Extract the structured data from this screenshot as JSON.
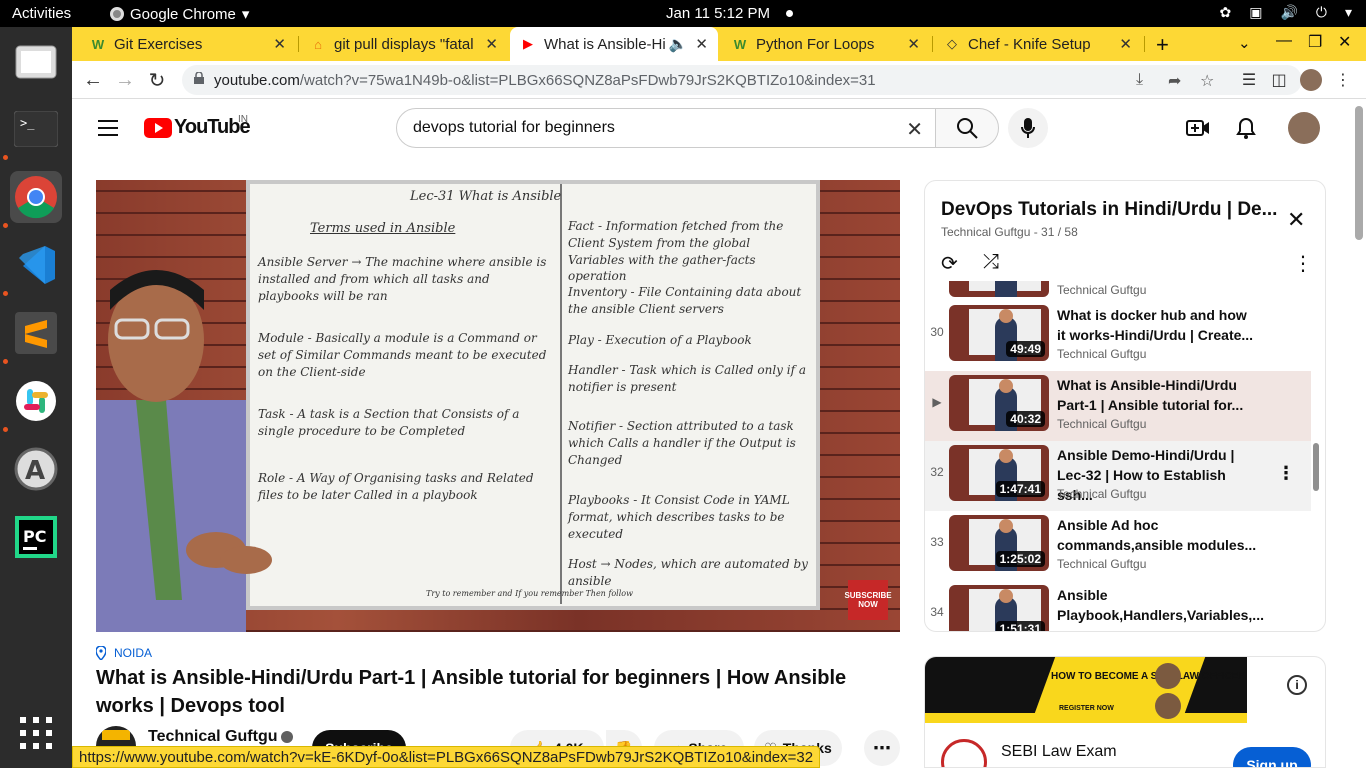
{
  "topbar": {
    "activities": "Activities",
    "app_name": "Google Chrome",
    "datetime": "Jan 11  5:12 PM"
  },
  "dock": {
    "apps": [
      "files-icon",
      "terminal-icon",
      "chrome-icon",
      "vscode-icon",
      "sublime-icon",
      "slack-icon",
      "software-updater-icon",
      "pycharm-icon",
      "app-grid-icon"
    ]
  },
  "tabs": [
    {
      "title": "Git Exercises",
      "favicon": "W"
    },
    {
      "title": "git pull displays \"fatal",
      "favicon": "⌂"
    },
    {
      "title": "What is Ansible-Hi",
      "favicon": "▶",
      "active": true
    },
    {
      "title": "Python For Loops",
      "favicon": "W"
    },
    {
      "title": "Chef - Knife Setup",
      "favicon": "◇"
    }
  ],
  "address_bar": {
    "domain": "youtube.com",
    "path": "/watch?v=75wa1N49b-o&list=PLBGx66SQNZ8aPsFDwb79JrS2KQBTIZo10&index=31"
  },
  "youtube": {
    "logo_text": "YouTube",
    "country": "IN",
    "search_value": "devops tutorial for beginners"
  },
  "video": {
    "location": "NOIDA",
    "title": "What is Ansible-Hindi/Urdu Part-1 | Ansible tutorial for beginners | How Ansible works | Devops tool",
    "channel": "Technical Guftgu",
    "subscribe_label": "Subscribe",
    "likes": "4.0K",
    "share_label": "Share",
    "thanks_label": "Thanks",
    "whiteboard": {
      "header": "Lec-31  What is Ansible",
      "left_title": "Terms used in Ansible",
      "left": [
        "Ansible Server → The machine where ansible is installed and from which all tasks and playbooks will be ran",
        "Module - Basically a module is a Command or set of Similar Commands meant to be executed on the Client-side",
        "Task - A task is a Section that Consists of a single procedure to be Completed",
        "Role - A Way of Organising tasks and Related files to be later Called in a playbook"
      ],
      "right": [
        "Fact - Information fetched from the Client System from the global Variables with the gather-facts operation",
        "Inventory - File Containing data about the ansible Client servers",
        "Play - Execution of a Playbook",
        "Handler - Task which is Called only if a notifier is present",
        "Notifier - Section attributed to a task which Calls a handler if the Output is Changed",
        "Playbooks - It Consist Code in YAML format, which describes tasks to be executed",
        "Host → Nodes, which are automated by ansible"
      ],
      "footer": "Try to remember and If you remember Then follow",
      "badge": "SUBSCRIBE NOW"
    }
  },
  "playlist": {
    "title": "DevOps Tutorials in Hindi/Urdu | De...",
    "subtitle": "Technical Guftgu - 31 / 58",
    "items": [
      {
        "index": "",
        "title": "",
        "channel": "Technical Guftgu",
        "duration": ""
      },
      {
        "index": "30",
        "title": "What is docker hub and how it works-Hindi/Urdu | Create...",
        "channel": "Technical Guftgu",
        "duration": "49:49"
      },
      {
        "index": "▶",
        "title": "What is Ansible-Hindi/Urdu Part-1 | Ansible tutorial for...",
        "channel": "Technical Guftgu",
        "duration": "40:32"
      },
      {
        "index": "32",
        "title": "Ansible Demo-Hindi/Urdu | Lec-32 | How to Establish ssh...",
        "channel": "Technical Guftgu",
        "duration": "1:47:41"
      },
      {
        "index": "33",
        "title": "Ansible Ad hoc commands,ansible modules...",
        "channel": "Technical Guftgu",
        "duration": "1:25:02"
      },
      {
        "index": "34",
        "title": "Ansible Playbook,Handlers,Variables,...",
        "channel": "",
        "duration": "1:51:31"
      }
    ]
  },
  "ad": {
    "banner_text": "HOW TO BECOME A SEBI LAW OFFICER",
    "banner_cta": "REGISTER NOW",
    "name": "SEBI Law Exam",
    "button": "Sign up"
  },
  "status_url": "https://www.youtube.com/watch?v=kE-6KDyf-0o&list=PLBGx66SQNZ8aPsFDwb79JrS2KQBTIZo10&index=32",
  "colors": {
    "tab_strip": "#fdd835",
    "youtube_red": "#ff0000",
    "link_blue": "#065fd4",
    "current_item": "#f1e5e2"
  }
}
